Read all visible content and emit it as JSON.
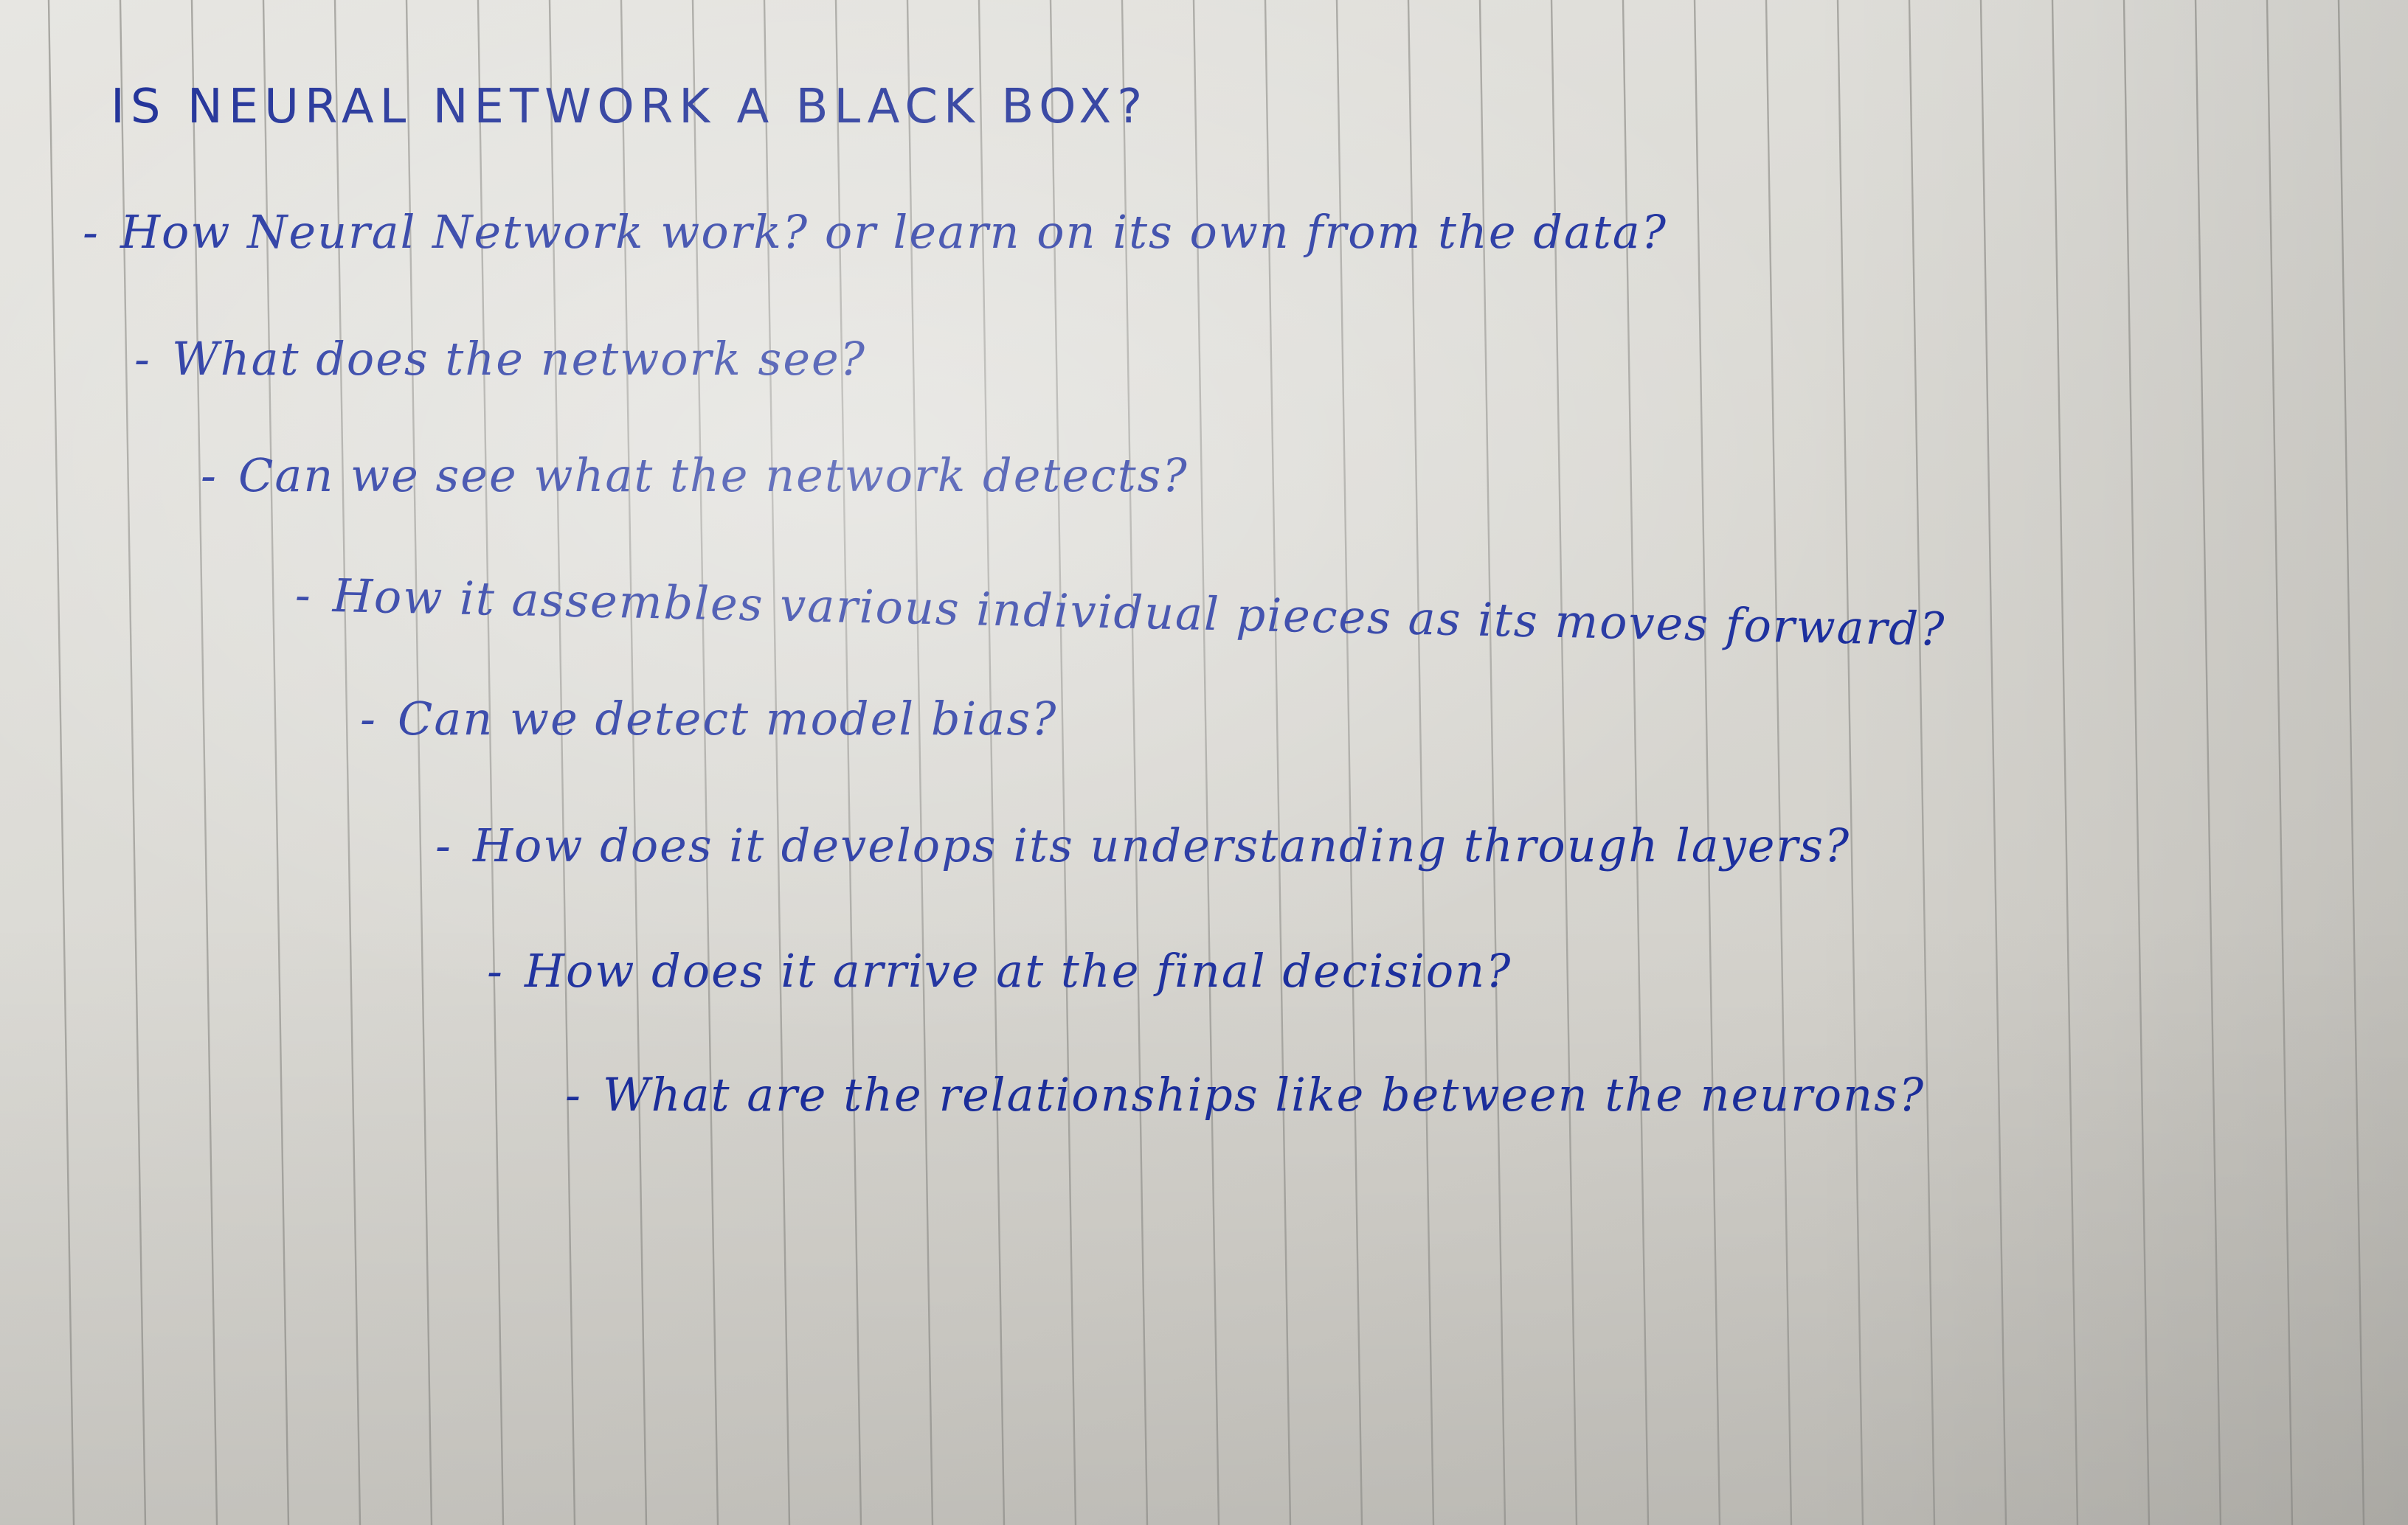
{
  "note": {
    "heading": "IS NEURAL NETWORK A BLACK BOX?",
    "lines": [
      {
        "dash": "-",
        "text": "How Neural Network work? or learn on its own from the data?"
      },
      {
        "dash": "-",
        "text": "What does the network see?"
      },
      {
        "dash": "-",
        "text": "Can we see what the network detects?"
      },
      {
        "dash": "-",
        "text": "How it assembles various individual pieces as its moves forward?"
      },
      {
        "dash": "-",
        "text": "Can we detect model bias?"
      },
      {
        "dash": "-",
        "text": "How does it develops its understanding through layers?"
      },
      {
        "dash": "-",
        "text": "How does it arrive at the final decision?"
      },
      {
        "dash": "-",
        "text": "What are the relationships like between the neurons?"
      }
    ]
  },
  "colors": {
    "ink": "#1c2f9e",
    "paper": "#e2e1dc",
    "rule": "#a9a8a3"
  }
}
